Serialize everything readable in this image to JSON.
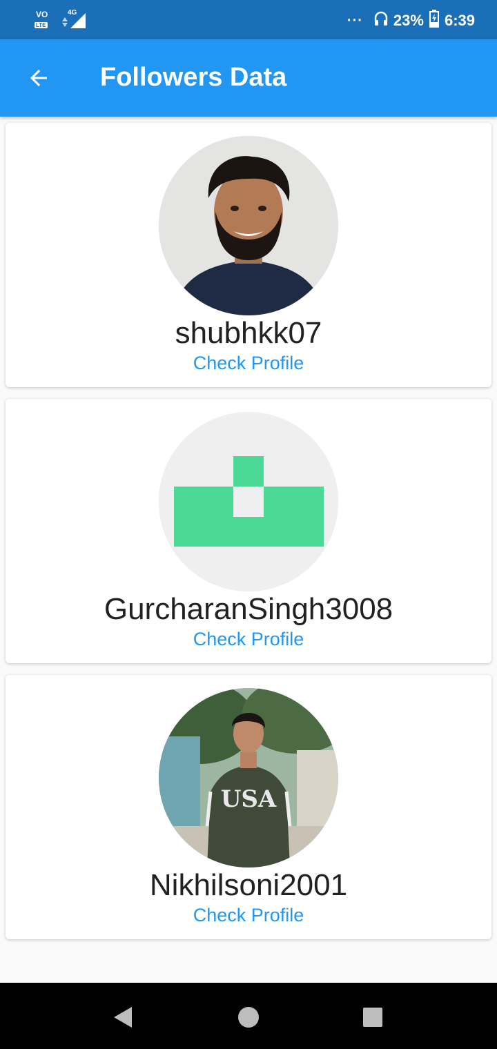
{
  "status_bar": {
    "left_icons": [
      "volte-icon",
      "4g-signal-icon"
    ],
    "network_label": "4G",
    "volte_label": "VO",
    "lte_label": "LTE",
    "more_indicator": "···",
    "battery_percent": "23%",
    "time": "6:39"
  },
  "app_bar": {
    "title": "Followers Data",
    "back_icon": "arrow-back-icon",
    "color": "#2196f3"
  },
  "followers": [
    {
      "username": "shubhkk07",
      "link_label": "Check Profile",
      "avatar": "photo"
    },
    {
      "username": "GurcharanSingh3008",
      "link_label": "Check Profile",
      "avatar": "identicon",
      "identicon_color": "#4cd996"
    },
    {
      "username": "Nikhilsoni2001",
      "link_label": "Check Profile",
      "avatar": "photo"
    }
  ],
  "nav_bar": {
    "buttons": [
      "back-triangle-icon",
      "home-circle-icon",
      "recents-square-icon"
    ]
  },
  "colors": {
    "status_bar": "#1a6fb8",
    "link": "#2196f3",
    "background": "#fafafa"
  }
}
